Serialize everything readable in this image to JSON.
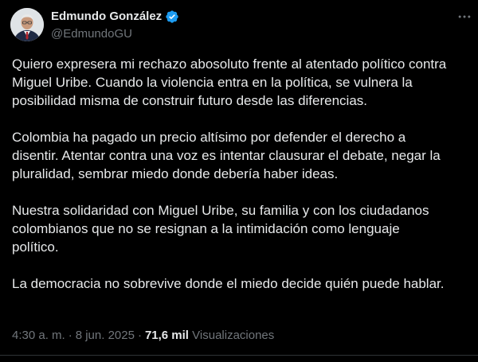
{
  "author": {
    "display_name": "Edmundo González",
    "handle": "@EdmundoGU",
    "verified": true,
    "verified_color": "#1d9bf0"
  },
  "tweet": {
    "paragraphs": [
      [
        "Quiero expresera mi rechazo abosoluto frente al atentado político contra",
        "Miguel Uribe. Cuando la violencia entra en la política, se vulnera la",
        "posibilidad misma de construir futuro desde las diferencias."
      ],
      [
        "Colombia ha pagado un precio altísimo por defender el derecho a",
        "disentir. Atentar contra una voz es intentar clausurar el debate, negar la",
        "pluralidad, sembrar miedo donde debería haber ideas."
      ],
      [
        "Nuestra solidaridad con Miguel Uribe, su familia y con los ciudadanos",
        "colombianos que no se resignan a la intimidación como lenguaje",
        "político."
      ],
      [
        "La democracia no sobrevive donde el miedo decide quién puede hablar."
      ]
    ]
  },
  "meta": {
    "time": "4:30 a. m.",
    "separator": "·",
    "date": "8 jun. 2025",
    "views_count": "71,6 mil",
    "views_label": "Visualizaciones"
  },
  "icons": {
    "avatar": "avatar",
    "verified": "verified-badge-icon",
    "more": "more-options-icon"
  }
}
